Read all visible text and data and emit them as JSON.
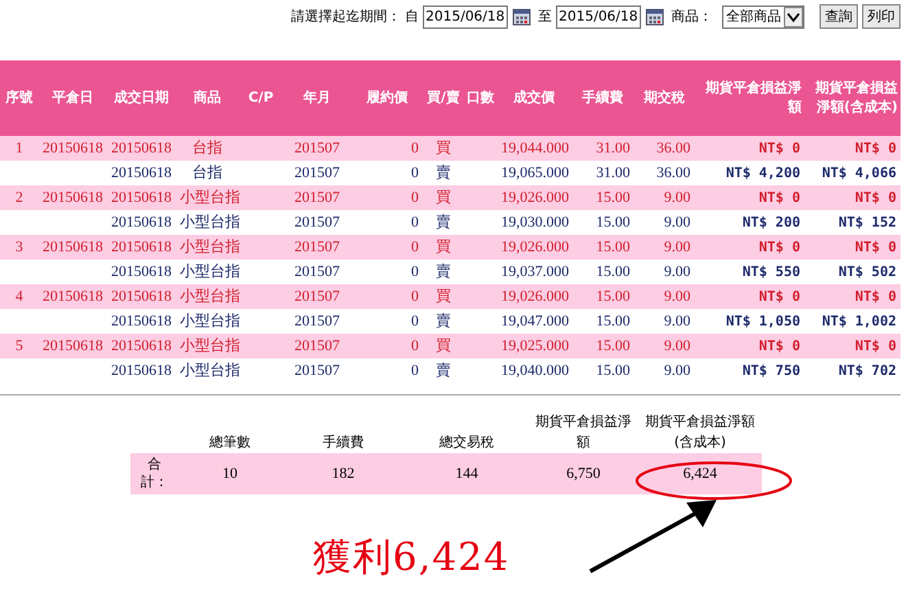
{
  "filter": {
    "period_label": "請選擇起迄期間：",
    "from_label": "自",
    "from_value": "2015/06/18",
    "to_label": "至",
    "to_value": "2015/06/18",
    "product_label": "商品：",
    "product_value": "全部商品",
    "buttons": [
      "查詢",
      "列印"
    ]
  },
  "table": {
    "columns": [
      "序號",
      "平倉日",
      "成交日期",
      "商品",
      "C/P",
      "年月",
      "履約價",
      "買/賣",
      "口數",
      "成交價",
      "手續費",
      "期交稅",
      "期貨平倉損益淨額",
      "期貨平倉損益淨額(含成本)"
    ],
    "rows": [
      {
        "shaded": true,
        "cells": [
          "1",
          "20150618",
          "20150618",
          "台指",
          "",
          "201507",
          "0",
          "買",
          "",
          "19,044.000",
          "31.00",
          "36.00",
          "NT$ 0",
          "NT$ 0"
        ]
      },
      {
        "shaded": false,
        "cells": [
          "",
          "",
          "20150618",
          "台指",
          "",
          "201507",
          "0",
          "賣",
          "",
          "19,065.000",
          "31.00",
          "36.00",
          "NT$ 4,200",
          "NT$ 4,066"
        ]
      },
      {
        "shaded": true,
        "cells": [
          "2",
          "20150618",
          "20150618",
          "小型台指",
          "",
          "201507",
          "0",
          "買",
          "",
          "19,026.000",
          "15.00",
          "9.00",
          "NT$ 0",
          "NT$ 0"
        ]
      },
      {
        "shaded": false,
        "cells": [
          "",
          "",
          "20150618",
          "小型台指",
          "",
          "201507",
          "0",
          "賣",
          "",
          "19,030.000",
          "15.00",
          "9.00",
          "NT$ 200",
          "NT$ 152"
        ]
      },
      {
        "shaded": true,
        "cells": [
          "3",
          "20150618",
          "20150618",
          "小型台指",
          "",
          "201507",
          "0",
          "買",
          "",
          "19,026.000",
          "15.00",
          "9.00",
          "NT$ 0",
          "NT$ 0"
        ]
      },
      {
        "shaded": false,
        "cells": [
          "",
          "",
          "20150618",
          "小型台指",
          "",
          "201507",
          "0",
          "賣",
          "",
          "19,037.000",
          "15.00",
          "9.00",
          "NT$ 550",
          "NT$ 502"
        ]
      },
      {
        "shaded": true,
        "cells": [
          "4",
          "20150618",
          "20150618",
          "小型台指",
          "",
          "201507",
          "0",
          "買",
          "",
          "19,026.000",
          "15.00",
          "9.00",
          "NT$ 0",
          "NT$ 0"
        ]
      },
      {
        "shaded": false,
        "cells": [
          "",
          "",
          "20150618",
          "小型台指",
          "",
          "201507",
          "0",
          "賣",
          "",
          "19,047.000",
          "15.00",
          "9.00",
          "NT$ 1,050",
          "NT$ 1,002"
        ]
      },
      {
        "shaded": true,
        "cells": [
          "5",
          "20150618",
          "20150618",
          "小型台指",
          "",
          "201507",
          "0",
          "買",
          "",
          "19,025.000",
          "15.00",
          "9.00",
          "NT$ 0",
          "NT$ 0"
        ]
      },
      {
        "shaded": false,
        "cells": [
          "",
          "",
          "20150618",
          "小型台指",
          "",
          "201507",
          "0",
          "賣",
          "",
          "19,040.000",
          "15.00",
          "9.00",
          "NT$ 750",
          "NT$ 702"
        ]
      }
    ]
  },
  "summary": {
    "columns": [
      "總筆數",
      "手續費",
      "總交易稅",
      "期貨平倉損益淨額",
      "期貨平倉損益淨額(含成本)"
    ],
    "row_label": "合計：",
    "values": [
      "10",
      "182",
      "144",
      "6,750",
      "6,424"
    ]
  },
  "annotation": {
    "text": "獲利6,424"
  }
}
